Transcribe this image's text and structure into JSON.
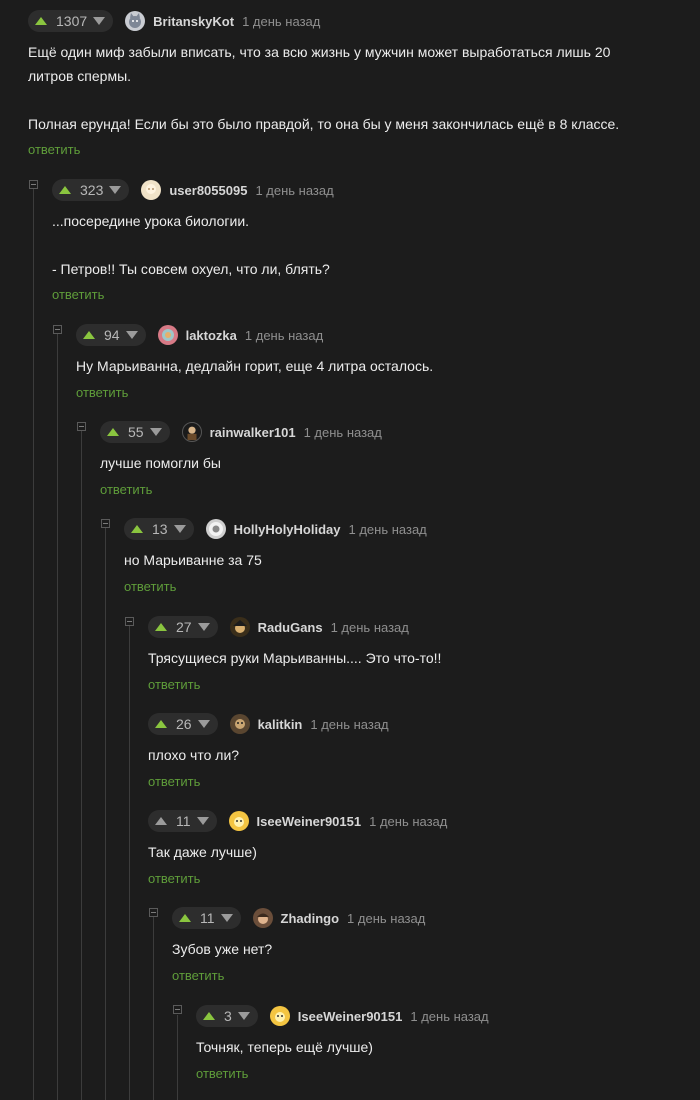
{
  "reply_label": "ответить",
  "colors": {
    "background": "#1c1c1c",
    "upvote": "#8ac53f",
    "reply_link": "#5f9d3a"
  },
  "comments": [
    {
      "votes": "1307",
      "user": "BritanskyKot",
      "time": "1 день назад",
      "avatar_icon": "cat-avatar",
      "lines": [
        "Ещё один миф забыли вписать, что за всю жизнь у мужчин может выработаться лишь 20",
        "литров спермы.",
        "",
        "Полная ерунда! Если бы это было правдой, то она бы у меня закончилась ещё в 8 классе."
      ]
    },
    {
      "votes": "323",
      "user": "user8055095",
      "time": "1 день назад",
      "avatar_icon": "default-avatar",
      "lines": [
        "...посередине урока биологии.",
        "",
        "- Петров!! Ты совсем охуел, что ли, блять?"
      ]
    },
    {
      "votes": "94",
      "user": "laktozka",
      "time": "1 день назад",
      "avatar_icon": "user-avatar",
      "lines": [
        "Ну Марьиванна, дедлайн горит, еще 4 литра осталось."
      ]
    },
    {
      "votes": "55",
      "user": "rainwalker101",
      "time": "1 день назад",
      "avatar_icon": "user-avatar",
      "lines": [
        "лучше помогли бы"
      ]
    },
    {
      "votes": "13",
      "user": "HollyHolyHoliday",
      "time": "1 день назад",
      "avatar_icon": "user-avatar",
      "lines": [
        "но Марьиванне за 75"
      ]
    },
    {
      "votes": "27",
      "user": "RaduGans",
      "time": "1 день назад",
      "avatar_icon": "user-avatar",
      "lines": [
        "Трясущиеся руки Марьиванны.... Это что-то!!"
      ]
    },
    {
      "votes": "26",
      "user": "kalitkin",
      "time": "1 день назад",
      "avatar_icon": "user-avatar",
      "lines": [
        "плохо что ли?"
      ]
    },
    {
      "votes": "11",
      "user": "IseeWeiner90151",
      "time": "1 день назад",
      "avatar_icon": "user-avatar",
      "lines": [
        "Так даже лучше)"
      ]
    },
    {
      "votes": "11",
      "user": "Zhadingo",
      "time": "1 день назад",
      "avatar_icon": "user-avatar",
      "lines": [
        "Зубов уже нет?"
      ]
    },
    {
      "votes": "3",
      "user": "IseeWeiner90151",
      "time": "1 день назад",
      "avatar_icon": "user-avatar",
      "lines": [
        "Точняк, теперь ещё лучше)"
      ]
    }
  ]
}
